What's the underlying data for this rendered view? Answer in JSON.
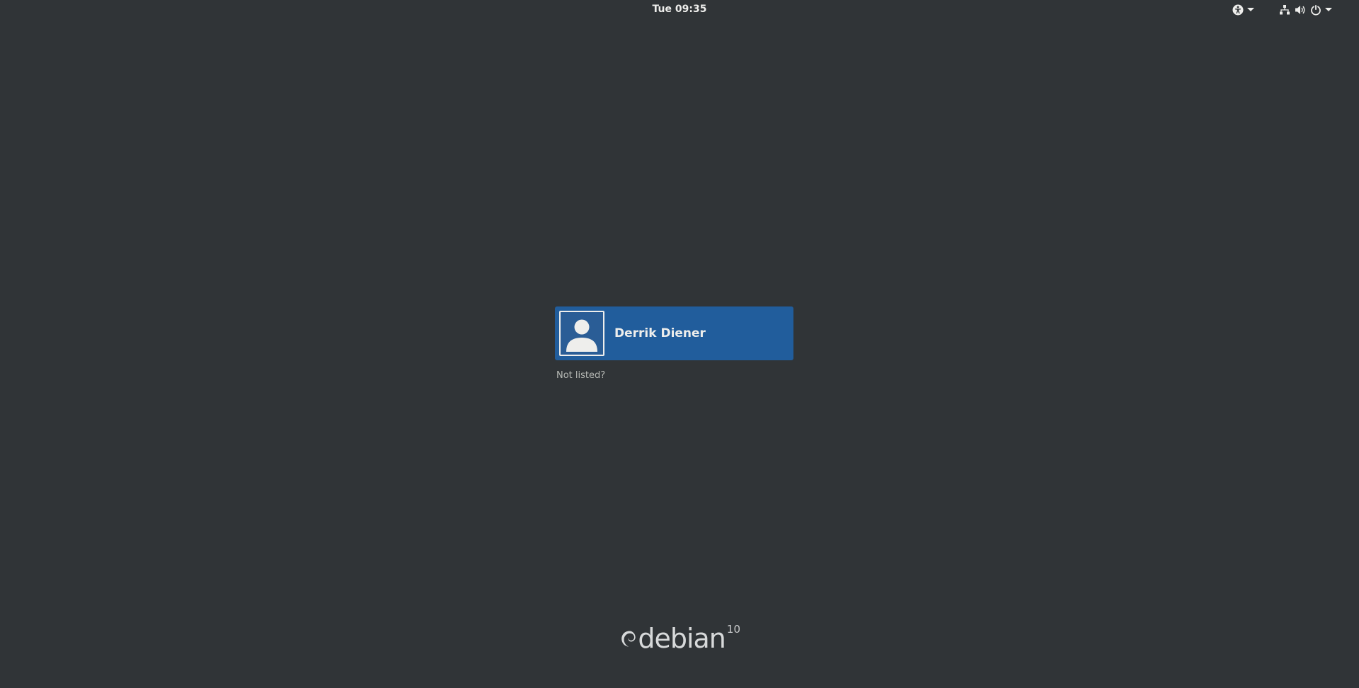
{
  "topbar": {
    "clock": "Tue 09:35",
    "icons": [
      "accessibility-icon",
      "network-icon",
      "volume-icon",
      "power-icon"
    ]
  },
  "login": {
    "user_name": "Derrik Diener",
    "not_listed": "Not listed?"
  },
  "branding": {
    "word": "debian",
    "version": "10"
  },
  "colors": {
    "background": "#303437",
    "selected_user": "#215d9c",
    "text": "#eeeeec"
  }
}
